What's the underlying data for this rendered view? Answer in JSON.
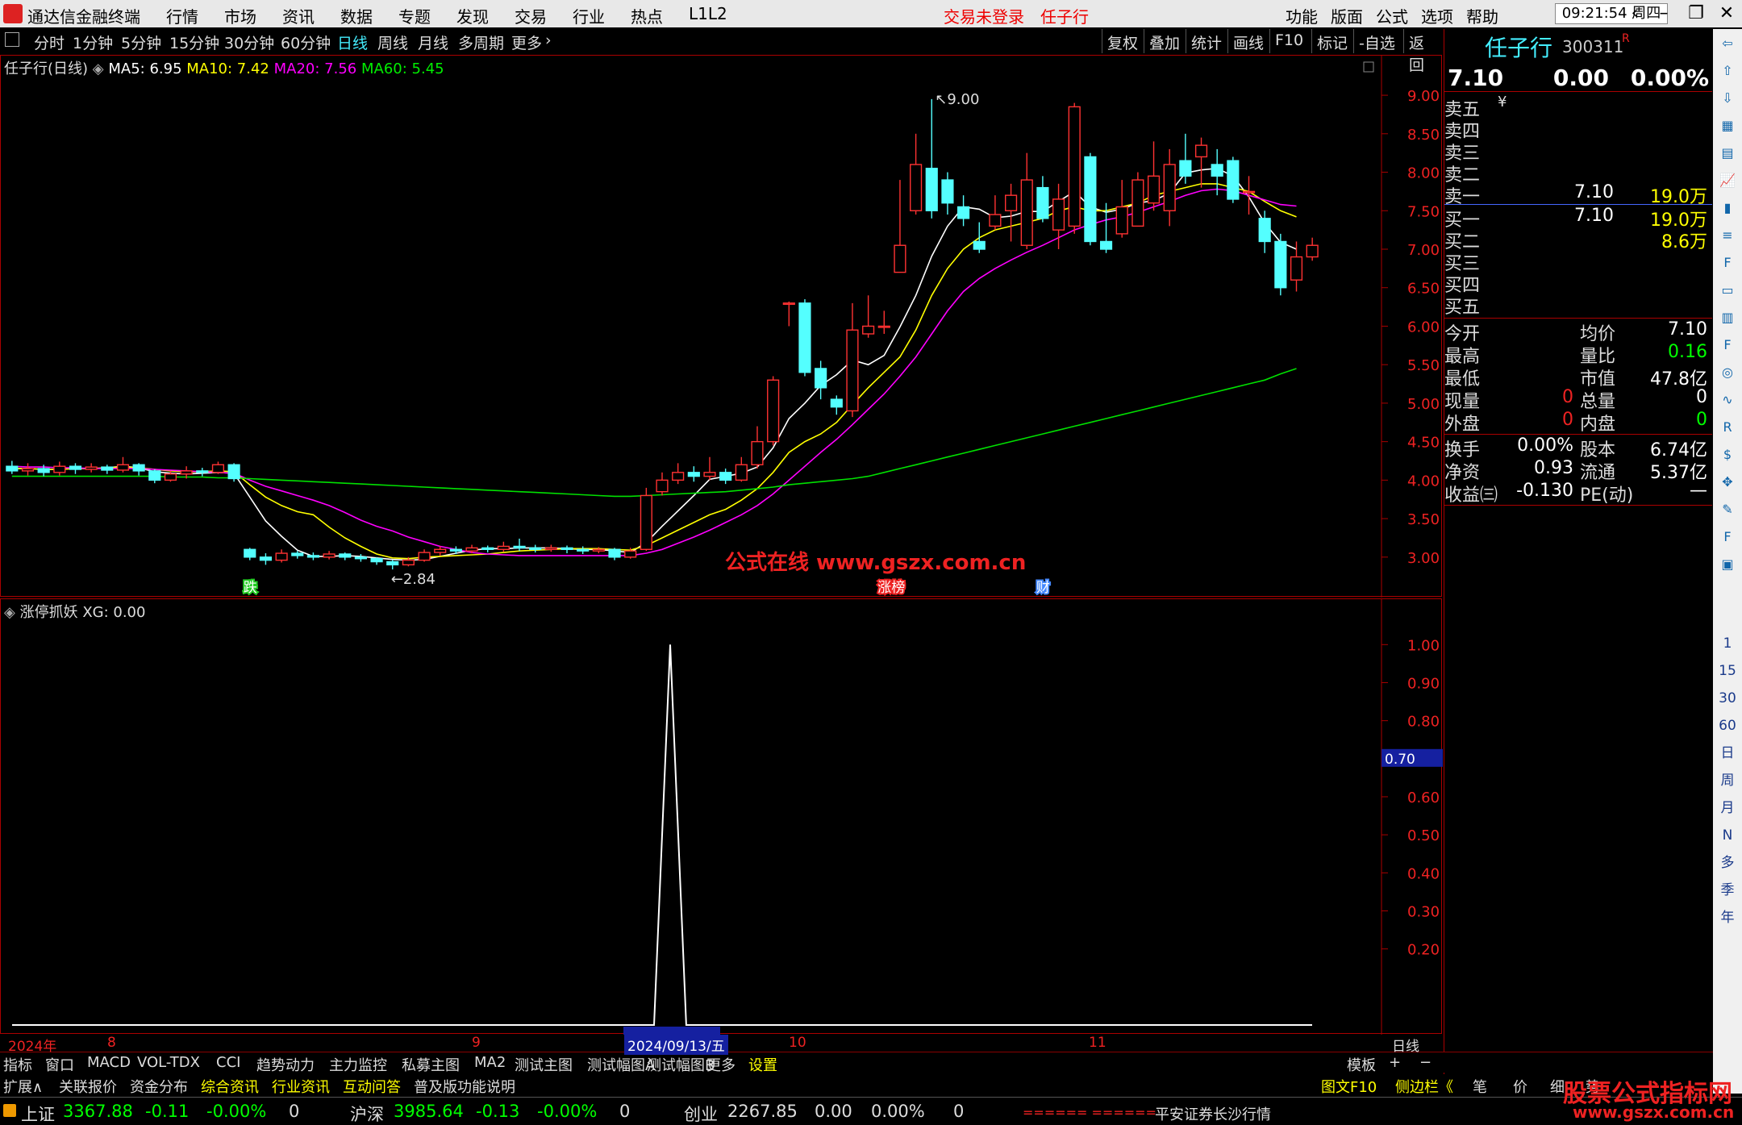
{
  "app": {
    "title": "通达信金融终端",
    "menus": [
      "行情",
      "市场",
      "资讯",
      "数据",
      "专题",
      "发现",
      "交易",
      "行业",
      "热点",
      "L1L2"
    ],
    "login_status": "交易未登录",
    "stock_name_title": "任子行",
    "right_menus": [
      "功能",
      "版面",
      "公式",
      "选项",
      "帮助"
    ],
    "clock": "09:21:54",
    "weekday": "周四"
  },
  "periods": [
    "分时",
    "1分钟",
    "5分钟",
    "15分钟",
    "30分钟",
    "60分钟",
    "日线",
    "周线",
    "月线",
    "多周期",
    "更多"
  ],
  "active_period": "日线",
  "tools": [
    "复权",
    "叠加",
    "统计",
    "画线",
    "F10",
    "标记",
    "-自选",
    "返回"
  ],
  "main_chart": {
    "title": "任子行(日线)",
    "ma5": "MA5: 6.95",
    "ma10": "MA10: 7.42",
    "ma20": "MA20: 7.56",
    "ma60": "MA60: 5.45",
    "y_ticks": [
      "9.00",
      "8.50",
      "8.00",
      "7.50",
      "7.00",
      "6.50",
      "6.00",
      "5.50",
      "5.00",
      "4.50",
      "4.00",
      "3.50",
      "3.00"
    ],
    "high_label": "9.00",
    "low_label": "2.84",
    "markers": [
      "跌",
      "涨榜",
      "财"
    ],
    "watermark": "公式在线  www.gszx.com.cn"
  },
  "chart_data": [
    {
      "type": "candlestick",
      "title": "任子行(日线)",
      "ylim": [
        2.6,
        9.2
      ],
      "candles": [
        [
          4.18,
          4.12,
          4.25,
          4.08
        ],
        [
          4.12,
          4.15,
          4.22,
          4.06
        ],
        [
          4.15,
          4.1,
          4.2,
          4.05
        ],
        [
          4.1,
          4.18,
          4.24,
          4.06
        ],
        [
          4.18,
          4.14,
          4.22,
          4.08
        ],
        [
          4.14,
          4.17,
          4.22,
          4.1
        ],
        [
          4.17,
          4.13,
          4.2,
          4.08
        ],
        [
          4.13,
          4.2,
          4.3,
          4.1
        ],
        [
          4.2,
          4.12,
          4.22,
          4.06
        ],
        [
          4.12,
          4.0,
          4.14,
          3.96
        ],
        [
          4.0,
          4.08,
          4.12,
          3.98
        ],
        [
          4.08,
          4.12,
          4.18,
          4.02
        ],
        [
          4.12,
          4.1,
          4.16,
          4.05
        ],
        [
          4.1,
          4.2,
          4.24,
          4.08
        ],
        [
          4.2,
          4.02,
          4.22,
          3.98
        ],
        [
          3.1,
          3.0,
          3.12,
          2.96
        ],
        [
          3.0,
          2.96,
          3.05,
          2.9
        ],
        [
          2.96,
          3.05,
          3.1,
          2.93
        ],
        [
          3.05,
          3.02,
          3.08,
          2.98
        ],
        [
          3.02,
          3.0,
          3.06,
          2.96
        ],
        [
          3.0,
          3.04,
          3.08,
          2.97
        ],
        [
          3.04,
          3.0,
          3.06,
          2.96
        ],
        [
          3.0,
          2.98,
          3.04,
          2.94
        ],
        [
          2.98,
          2.94,
          3.0,
          2.9
        ],
        [
          2.94,
          2.9,
          2.96,
          2.84
        ],
        [
          2.9,
          2.96,
          3.0,
          2.88
        ],
        [
          2.96,
          3.06,
          3.1,
          2.94
        ],
        [
          3.06,
          3.1,
          3.14,
          3.02
        ],
        [
          3.1,
          3.08,
          3.14,
          3.04
        ],
        [
          3.08,
          3.12,
          3.16,
          3.05
        ],
        [
          3.12,
          3.1,
          3.15,
          3.06
        ],
        [
          3.1,
          3.14,
          3.2,
          3.07
        ],
        [
          3.14,
          3.12,
          3.24,
          3.08
        ],
        [
          3.12,
          3.1,
          3.16,
          3.06
        ],
        [
          3.1,
          3.12,
          3.16,
          3.07
        ],
        [
          3.12,
          3.1,
          3.15,
          3.05
        ],
        [
          3.1,
          3.08,
          3.14,
          3.04
        ],
        [
          3.08,
          3.1,
          3.13,
          3.05
        ],
        [
          3.1,
          3.0,
          3.12,
          2.96
        ],
        [
          3.0,
          3.08,
          3.12,
          2.98
        ],
        [
          3.1,
          3.8,
          3.9,
          3.08
        ],
        [
          3.85,
          4.0,
          4.1,
          3.8
        ],
        [
          4.0,
          4.1,
          4.22,
          3.95
        ],
        [
          4.1,
          4.05,
          4.18,
          3.98
        ],
        [
          4.05,
          4.1,
          4.3,
          4.0
        ],
        [
          4.1,
          4.0,
          4.15,
          3.95
        ],
        [
          4.0,
          4.2,
          4.3,
          3.98
        ],
        [
          4.2,
          4.5,
          4.7,
          4.15
        ],
        [
          4.5,
          5.3,
          5.35,
          4.45
        ],
        [
          6.3,
          6.3,
          6.32,
          6.0
        ],
        [
          6.3,
          5.4,
          6.35,
          5.35
        ],
        [
          5.45,
          5.2,
          5.55,
          5.05
        ],
        [
          5.05,
          4.95,
          5.1,
          4.85
        ],
        [
          4.9,
          5.95,
          6.3,
          4.82
        ],
        [
          5.9,
          6.0,
          6.4,
          5.85
        ],
        [
          6.0,
          6.0,
          6.2,
          5.9
        ],
        [
          6.7,
          7.05,
          7.9,
          6.7
        ],
        [
          7.5,
          8.1,
          8.5,
          7.45
        ],
        [
          8.05,
          7.5,
          8.95,
          7.4
        ],
        [
          7.9,
          7.6,
          8.0,
          7.45
        ],
        [
          7.55,
          7.4,
          7.7,
          7.3
        ],
        [
          7.1,
          7.0,
          7.35,
          6.95
        ],
        [
          7.3,
          7.45,
          7.7,
          7.25
        ],
        [
          7.5,
          7.7,
          7.85,
          7.1
        ],
        [
          7.05,
          7.9,
          8.25,
          7.0
        ],
        [
          7.8,
          7.4,
          7.95,
          7.35
        ],
        [
          7.25,
          7.65,
          7.85,
          7.0
        ],
        [
          7.3,
          8.85,
          8.9,
          7.2
        ],
        [
          8.2,
          7.1,
          8.25,
          7.05
        ],
        [
          7.1,
          7.0,
          7.6,
          6.95
        ],
        [
          7.2,
          7.55,
          7.9,
          7.15
        ],
        [
          7.3,
          7.9,
          8.0,
          7.3
        ],
        [
          7.6,
          7.95,
          8.4,
          7.5
        ],
        [
          7.5,
          8.1,
          8.3,
          7.3
        ],
        [
          8.15,
          7.95,
          8.5,
          7.85
        ],
        [
          8.2,
          8.35,
          8.45,
          7.8
        ],
        [
          8.1,
          7.95,
          8.3,
          7.7
        ],
        [
          8.15,
          7.65,
          8.2,
          7.6
        ],
        [
          7.75,
          7.75,
          7.95,
          7.45
        ],
        [
          7.4,
          7.1,
          7.5,
          6.95
        ],
        [
          7.1,
          6.5,
          7.2,
          6.4
        ],
        [
          6.6,
          6.9,
          7.1,
          6.45
        ],
        [
          6.9,
          7.05,
          7.15,
          6.85
        ]
      ],
      "series": [
        {
          "name": "MA5",
          "color": "#ffffff",
          "values": [
            4.15,
            4.15,
            4.14,
            4.14,
            4.15,
            4.15,
            4.16,
            4.18,
            4.16,
            4.11,
            4.09,
            4.08,
            4.09,
            4.1,
            4.09,
            3.78,
            3.47,
            3.27,
            3.09,
            3.01,
            3.01,
            3.02,
            3.01,
            2.99,
            2.97,
            2.96,
            2.97,
            3.01,
            3.05,
            3.09,
            3.11,
            3.11,
            3.12,
            3.12,
            3.12,
            3.11,
            3.1,
            3.1,
            3.08,
            3.06,
            3.19,
            3.4,
            3.6,
            3.8,
            4.01,
            4.05,
            4.09,
            4.17,
            4.42,
            4.8,
            5.0,
            5.23,
            5.37,
            5.56,
            5.5,
            5.62,
            5.99,
            6.4,
            6.91,
            7.3,
            7.55,
            7.52,
            7.41,
            7.43,
            7.49,
            7.49,
            7.62,
            7.75,
            7.55,
            7.48,
            7.52,
            7.6,
            7.63,
            7.73,
            7.99,
            8.03,
            8.05,
            7.95,
            7.68,
            7.34,
            7.09,
            7.0
          ]
        },
        {
          "name": "MA10",
          "color": "#ffff00",
          "values": [
            4.15,
            4.15,
            4.14,
            4.14,
            4.15,
            4.15,
            4.16,
            4.17,
            4.16,
            4.14,
            4.12,
            4.11,
            4.11,
            4.12,
            4.11,
            3.94,
            3.78,
            3.67,
            3.59,
            3.55,
            3.39,
            3.25,
            3.14,
            3.04,
            2.99,
            2.98,
            3.0,
            3.01,
            3.02,
            3.03,
            3.04,
            3.06,
            3.08,
            3.09,
            3.1,
            3.11,
            3.11,
            3.11,
            3.1,
            3.09,
            3.15,
            3.25,
            3.35,
            3.45,
            3.55,
            3.62,
            3.74,
            3.89,
            4.1,
            4.36,
            4.5,
            4.6,
            4.75,
            4.98,
            5.2,
            5.4,
            5.6,
            5.95,
            6.4,
            6.75,
            7.0,
            7.15,
            7.25,
            7.3,
            7.35,
            7.4,
            7.5,
            7.55,
            7.5,
            7.5,
            7.55,
            7.6,
            7.7,
            7.75,
            7.8,
            7.85,
            7.85,
            7.8,
            7.75,
            7.62,
            7.5,
            7.42
          ]
        },
        {
          "name": "MA20",
          "color": "#ff00ff",
          "values": [
            4.18,
            4.17,
            4.17,
            4.16,
            4.16,
            4.15,
            4.15,
            4.15,
            4.15,
            4.14,
            4.13,
            4.12,
            4.11,
            4.1,
            4.09,
            4.0,
            3.92,
            3.86,
            3.8,
            3.74,
            3.67,
            3.58,
            3.48,
            3.4,
            3.34,
            3.26,
            3.2,
            3.14,
            3.1,
            3.06,
            3.04,
            3.03,
            3.02,
            3.02,
            3.02,
            3.02,
            3.02,
            3.02,
            3.02,
            3.02,
            3.05,
            3.1,
            3.18,
            3.26,
            3.35,
            3.45,
            3.55,
            3.67,
            3.82,
            4.0,
            4.18,
            4.36,
            4.53,
            4.72,
            4.92,
            5.12,
            5.35,
            5.6,
            5.9,
            6.2,
            6.45,
            6.62,
            6.75,
            6.86,
            6.96,
            7.05,
            7.15,
            7.25,
            7.32,
            7.38,
            7.42,
            7.48,
            7.55,
            7.62,
            7.7,
            7.76,
            7.78,
            7.76,
            7.7,
            7.64,
            7.58,
            7.56
          ]
        },
        {
          "name": "MA60",
          "color": "#00e000",
          "values": [
            4.05,
            4.05,
            4.05,
            4.05,
            4.05,
            4.05,
            4.05,
            4.05,
            4.05,
            4.05,
            4.04,
            4.04,
            4.04,
            4.03,
            4.03,
            4.02,
            4.01,
            4.0,
            3.99,
            3.98,
            3.97,
            3.96,
            3.95,
            3.94,
            3.93,
            3.92,
            3.91,
            3.9,
            3.89,
            3.88,
            3.87,
            3.86,
            3.85,
            3.84,
            3.83,
            3.82,
            3.81,
            3.8,
            3.79,
            3.79,
            3.8,
            3.81,
            3.82,
            3.83,
            3.84,
            3.85,
            3.87,
            3.89,
            3.91,
            3.94,
            3.96,
            3.98,
            4.0,
            4.02,
            4.05,
            4.1,
            4.15,
            4.2,
            4.25,
            4.3,
            4.35,
            4.4,
            4.45,
            4.5,
            4.55,
            4.6,
            4.65,
            4.7,
            4.75,
            4.8,
            4.85,
            4.9,
            4.95,
            5.0,
            5.05,
            5.1,
            5.15,
            5.2,
            5.25,
            5.3,
            5.38,
            5.45
          ]
        }
      ]
    },
    {
      "type": "line",
      "title": "涨停抓妖",
      "series": [
        {
          "name": "XG",
          "color": "#ffffff",
          "values": [
            0,
            0,
            0,
            0,
            0,
            0,
            0,
            0,
            0,
            0,
            0,
            0,
            0,
            0,
            0,
            0,
            0,
            0,
            0,
            0,
            0,
            0,
            0,
            0,
            0,
            0,
            0,
            0,
            0,
            0,
            0,
            0,
            0,
            0,
            0,
            0,
            0,
            0,
            0,
            0,
            0,
            1,
            0,
            0,
            0,
            0,
            0,
            0,
            0,
            0,
            0,
            0,
            0,
            0,
            0,
            0,
            0,
            0,
            0,
            0,
            0,
            0,
            0,
            0,
            0,
            0,
            0,
            0,
            0,
            0,
            0,
            0,
            0,
            0,
            0,
            0,
            0,
            0,
            0,
            0,
            0,
            0
          ]
        }
      ],
      "ylim": [
        0,
        1.06
      ],
      "y_ticks": [
        "1.00",
        "0.90",
        "0.80",
        "0.70",
        "0.60",
        "0.50",
        "0.40",
        "0.30",
        "0.20"
      ]
    }
  ],
  "indicator": {
    "title": "涨停抓妖",
    "xg": "XG: 0.00",
    "cursor_value": "0.70",
    "x_labels": [
      "2024年",
      "8",
      "9",
      "2024/09/13/五",
      "10",
      "11"
    ],
    "period_label": "日线"
  },
  "right_panel": {
    "name": "任子行",
    "code": "300311",
    "r_mark": "R",
    "price": "7.10",
    "change": "0.00",
    "pct": "0.00%",
    "asks": [
      {
        "label": "卖五",
        "extra": "¥",
        "price": "",
        "vol": ""
      },
      {
        "label": "卖四",
        "extra": "",
        "price": "",
        "vol": ""
      },
      {
        "label": "卖三",
        "extra": "",
        "price": "",
        "vol": ""
      },
      {
        "label": "卖二",
        "extra": "",
        "price": "",
        "vol": ""
      },
      {
        "label": "卖一",
        "extra": "",
        "price": "7.10",
        "vol": "19.0万"
      }
    ],
    "bids": [
      {
        "label": "买一",
        "price": "7.10",
        "vol": "19.0万"
      },
      {
        "label": "买二",
        "price": "",
        "vol": "8.6万"
      },
      {
        "label": "买三",
        "price": "",
        "vol": ""
      },
      {
        "label": "买四",
        "price": "",
        "vol": ""
      },
      {
        "label": "买五",
        "price": "",
        "vol": ""
      }
    ],
    "stats": [
      {
        "l1": "今开",
        "v1": "",
        "l2": "均价",
        "v2": "7.10",
        "c2": "#fff"
      },
      {
        "l1": "最高",
        "v1": "",
        "l2": "量比",
        "v2": "0.16",
        "c2": "#0f0"
      },
      {
        "l1": "最低",
        "v1": "",
        "l2": "市值",
        "v2": "47.8亿",
        "c2": "#fff"
      },
      {
        "l1": "现量",
        "v1": "0",
        "l2": "总量",
        "v2": "0",
        "c2": "#fff"
      },
      {
        "l1": "外盘",
        "v1": "0",
        "l2": "内盘",
        "v2": "0",
        "c2": "#0f0"
      }
    ],
    "finance": [
      {
        "l1": "换手",
        "v1": "0.00%",
        "l2": "股本",
        "v2": "6.74亿"
      },
      {
        "l1": "净资",
        "v1": "0.93",
        "l2": "流通",
        "v2": "5.37亿"
      },
      {
        "l1": "收益㈢",
        "v1": "-0.130",
        "l2": "PE(动)",
        "v2": "—"
      }
    ]
  },
  "bottom_tabs_1": [
    "指标",
    "窗口",
    "MACD",
    "VOL-TDX",
    "CCI",
    "趋势动力",
    "主力监控",
    "私募主图",
    "MA2",
    "测试主图",
    "测试幅图A",
    "测试幅图B",
    "更多",
    "设置"
  ],
  "bottom_right_1": [
    "模板",
    "+",
    "−"
  ],
  "bottom_tabs_2": [
    "扩展∧",
    "关联报价",
    "资金分布",
    "综合资讯",
    "行业资讯",
    "互动问答",
    "普及版功能说明"
  ],
  "bottom_right_2": [
    "图文F10",
    "侧边栏《",
    "笔",
    "价",
    "细",
    "势"
  ],
  "status": {
    "sh_label": "上证",
    "sh_val": "3367.88",
    "sh_chg": "-0.11",
    "sh_pct": "-0.00%",
    "sh_vol": "0",
    "hs_label": "沪深",
    "hs_val": "3985.64",
    "hs_chg": "-0.13",
    "hs_pct": "-0.00%",
    "hs_vol": "0",
    "cy_label": "创业",
    "cy_val": "2267.85",
    "cy_chg": "0.00",
    "cy_pct": "0.00%",
    "cy_vol": "0",
    "dashes": "====== ======",
    "broker": "平安证券长沙行情"
  },
  "sidebar_icons": [
    "arrow-left-icon",
    "arrow-up-icon",
    "arrow-down-icon",
    "grid-icon",
    "table-icon",
    "line-chart-icon",
    "candle-icon",
    "list-icon",
    "f10-icon",
    "doc-icon",
    "book-icon",
    "f12-icon",
    "circle-icon",
    "wave-icon",
    "rsi-icon",
    "dollar-icon",
    "move-icon",
    "pen-icon",
    "fs-icon",
    "image-icon"
  ],
  "sidebar_labels": [
    "1",
    "15",
    "30",
    "60",
    "日",
    "周",
    "月",
    "N",
    "多",
    "季",
    "年"
  ],
  "watermark_site": "股票公式指标网",
  "watermark_url": "www.gszx.com.cn"
}
